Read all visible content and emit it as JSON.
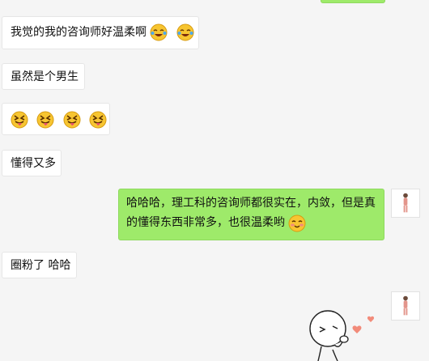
{
  "messages": [
    {
      "side": "left",
      "text": "我觉的我的咨询师好温柔啊",
      "emojis": [
        "laugh-cry-emoji",
        "laugh-cry-emoji"
      ]
    },
    {
      "side": "left",
      "text": "虽然是个男生"
    },
    {
      "side": "left",
      "text": "",
      "emojis": [
        "tongue-out-emoji",
        "tongue-out-emoji",
        "tongue-out-emoji",
        "tongue-out-emoji"
      ]
    },
    {
      "side": "left",
      "text": "懂得又多"
    },
    {
      "side": "right",
      "line1": "哈哈哈，理工科的咨询师都很实在，内敛，但是真",
      "line2": "的懂得东西非常多，也很温柔哟",
      "emojis": [
        "blush-emoji"
      ]
    },
    {
      "side": "left",
      "text": "圈粉了 哈哈"
    }
  ],
  "colors": {
    "background": "#f5f5f5",
    "sent_bubble": "#9eea6a",
    "received_bubble": "#ffffff"
  },
  "sticker": "waving-person-with-hearts-sticker"
}
